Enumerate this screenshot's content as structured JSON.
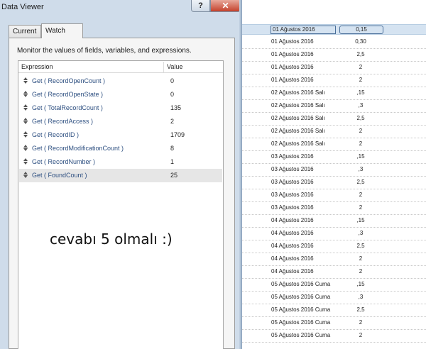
{
  "window": {
    "title": "Data Viewer",
    "help_glyph": "?",
    "close_glyph": "✕"
  },
  "tabs": [
    {
      "label": "Current"
    },
    {
      "label": "Watch"
    }
  ],
  "watch": {
    "instructions": "Monitor the values of fields, variables, and expressions.",
    "columns": {
      "expression": "Expression",
      "value": "Value"
    },
    "rows": [
      {
        "expr": "Get ( RecordOpenCount )",
        "value": "0"
      },
      {
        "expr": "Get ( RecordOpenState )",
        "value": "0"
      },
      {
        "expr": "Get ( TotalRecordCount )",
        "value": "135"
      },
      {
        "expr": "Get ( RecordAccess )",
        "value": "2"
      },
      {
        "expr": "Get ( RecordID )",
        "value": "1709"
      },
      {
        "expr": "Get ( RecordModificationCount )",
        "value": "8"
      },
      {
        "expr": "Get ( RecordNumber )",
        "value": "1"
      },
      {
        "expr": "Get ( FoundCount )",
        "value": "25"
      }
    ]
  },
  "annotation": "cevabı 5 olmalı :)",
  "background_table": [
    {
      "date": "01 Ağustos 2016",
      "value": "0,15"
    },
    {
      "date": "01 Ağustos 2016",
      "value": "0,30"
    },
    {
      "date": "01 Ağustos 2016",
      "value": "2,5"
    },
    {
      "date": "01 Ağustos 2016",
      "value": "2"
    },
    {
      "date": "01 Ağustos 2016",
      "value": "2"
    },
    {
      "date": "02 Ağustos 2016 Salı",
      "value": ",15"
    },
    {
      "date": "02 Ağustos 2016 Salı",
      "value": ",3"
    },
    {
      "date": "02 Ağustos 2016 Salı",
      "value": "2,5"
    },
    {
      "date": "02 Ağustos 2016 Salı",
      "value": "2"
    },
    {
      "date": "02 Ağustos 2016 Salı",
      "value": "2"
    },
    {
      "date": "03 Ağustos 2016",
      "value": ",15"
    },
    {
      "date": "03 Ağustos 2016",
      "value": ",3"
    },
    {
      "date": "03 Ağustos 2016",
      "value": "2,5"
    },
    {
      "date": "03 Ağustos 2016",
      "value": "2"
    },
    {
      "date": "03 Ağustos 2016",
      "value": "2"
    },
    {
      "date": "04 Ağustos 2016",
      "value": ",15"
    },
    {
      "date": "04 Ağustos 2016",
      "value": ",3"
    },
    {
      "date": "04 Ağustos 2016",
      "value": "2,5"
    },
    {
      "date": "04 Ağustos 2016",
      "value": "2"
    },
    {
      "date": "04 Ağustos 2016",
      "value": "2"
    },
    {
      "date": "05 Ağustos 2016 Cuma",
      "value": ",15"
    },
    {
      "date": "05 Ağustos 2016 Cuma",
      "value": ",3"
    },
    {
      "date": "05 Ağustos 2016 Cuma",
      "value": "2,5"
    },
    {
      "date": "05 Ağustos 2016 Cuma",
      "value": "2"
    },
    {
      "date": "05 Ağustos 2016 Cuma",
      "value": "2"
    }
  ]
}
